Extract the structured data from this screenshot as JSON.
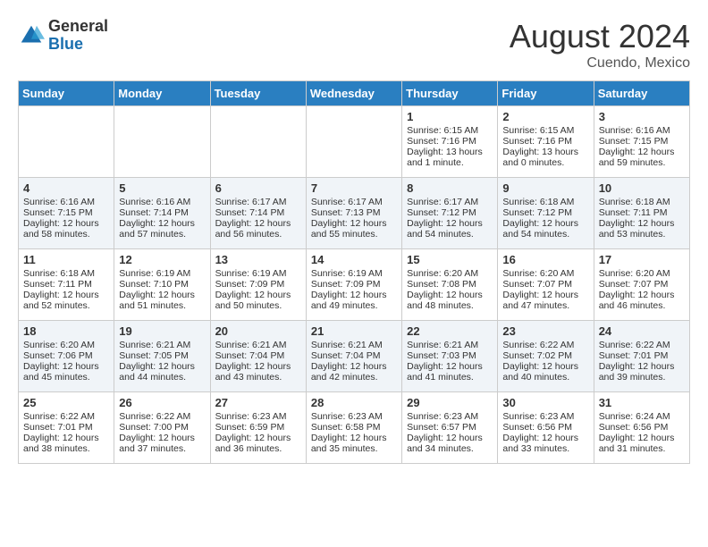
{
  "header": {
    "logo_general": "General",
    "logo_blue": "Blue",
    "month_year": "August 2024",
    "location": "Cuendo, Mexico"
  },
  "days_of_week": [
    "Sunday",
    "Monday",
    "Tuesday",
    "Wednesday",
    "Thursday",
    "Friday",
    "Saturday"
  ],
  "weeks": [
    [
      {
        "day": "",
        "sunrise": "",
        "sunset": "",
        "daylight": ""
      },
      {
        "day": "",
        "sunrise": "",
        "sunset": "",
        "daylight": ""
      },
      {
        "day": "",
        "sunrise": "",
        "sunset": "",
        "daylight": ""
      },
      {
        "day": "",
        "sunrise": "",
        "sunset": "",
        "daylight": ""
      },
      {
        "day": "1",
        "sunrise": "Sunrise: 6:15 AM",
        "sunset": "Sunset: 7:16 PM",
        "daylight": "Daylight: 13 hours and 1 minute."
      },
      {
        "day": "2",
        "sunrise": "Sunrise: 6:15 AM",
        "sunset": "Sunset: 7:16 PM",
        "daylight": "Daylight: 13 hours and 0 minutes."
      },
      {
        "day": "3",
        "sunrise": "Sunrise: 6:16 AM",
        "sunset": "Sunset: 7:15 PM",
        "daylight": "Daylight: 12 hours and 59 minutes."
      }
    ],
    [
      {
        "day": "4",
        "sunrise": "Sunrise: 6:16 AM",
        "sunset": "Sunset: 7:15 PM",
        "daylight": "Daylight: 12 hours and 58 minutes."
      },
      {
        "day": "5",
        "sunrise": "Sunrise: 6:16 AM",
        "sunset": "Sunset: 7:14 PM",
        "daylight": "Daylight: 12 hours and 57 minutes."
      },
      {
        "day": "6",
        "sunrise": "Sunrise: 6:17 AM",
        "sunset": "Sunset: 7:14 PM",
        "daylight": "Daylight: 12 hours and 56 minutes."
      },
      {
        "day": "7",
        "sunrise": "Sunrise: 6:17 AM",
        "sunset": "Sunset: 7:13 PM",
        "daylight": "Daylight: 12 hours and 55 minutes."
      },
      {
        "day": "8",
        "sunrise": "Sunrise: 6:17 AM",
        "sunset": "Sunset: 7:12 PM",
        "daylight": "Daylight: 12 hours and 54 minutes."
      },
      {
        "day": "9",
        "sunrise": "Sunrise: 6:18 AM",
        "sunset": "Sunset: 7:12 PM",
        "daylight": "Daylight: 12 hours and 54 minutes."
      },
      {
        "day": "10",
        "sunrise": "Sunrise: 6:18 AM",
        "sunset": "Sunset: 7:11 PM",
        "daylight": "Daylight: 12 hours and 53 minutes."
      }
    ],
    [
      {
        "day": "11",
        "sunrise": "Sunrise: 6:18 AM",
        "sunset": "Sunset: 7:11 PM",
        "daylight": "Daylight: 12 hours and 52 minutes."
      },
      {
        "day": "12",
        "sunrise": "Sunrise: 6:19 AM",
        "sunset": "Sunset: 7:10 PM",
        "daylight": "Daylight: 12 hours and 51 minutes."
      },
      {
        "day": "13",
        "sunrise": "Sunrise: 6:19 AM",
        "sunset": "Sunset: 7:09 PM",
        "daylight": "Daylight: 12 hours and 50 minutes."
      },
      {
        "day": "14",
        "sunrise": "Sunrise: 6:19 AM",
        "sunset": "Sunset: 7:09 PM",
        "daylight": "Daylight: 12 hours and 49 minutes."
      },
      {
        "day": "15",
        "sunrise": "Sunrise: 6:20 AM",
        "sunset": "Sunset: 7:08 PM",
        "daylight": "Daylight: 12 hours and 48 minutes."
      },
      {
        "day": "16",
        "sunrise": "Sunrise: 6:20 AM",
        "sunset": "Sunset: 7:07 PM",
        "daylight": "Daylight: 12 hours and 47 minutes."
      },
      {
        "day": "17",
        "sunrise": "Sunrise: 6:20 AM",
        "sunset": "Sunset: 7:07 PM",
        "daylight": "Daylight: 12 hours and 46 minutes."
      }
    ],
    [
      {
        "day": "18",
        "sunrise": "Sunrise: 6:20 AM",
        "sunset": "Sunset: 7:06 PM",
        "daylight": "Daylight: 12 hours and 45 minutes."
      },
      {
        "day": "19",
        "sunrise": "Sunrise: 6:21 AM",
        "sunset": "Sunset: 7:05 PM",
        "daylight": "Daylight: 12 hours and 44 minutes."
      },
      {
        "day": "20",
        "sunrise": "Sunrise: 6:21 AM",
        "sunset": "Sunset: 7:04 PM",
        "daylight": "Daylight: 12 hours and 43 minutes."
      },
      {
        "day": "21",
        "sunrise": "Sunrise: 6:21 AM",
        "sunset": "Sunset: 7:04 PM",
        "daylight": "Daylight: 12 hours and 42 minutes."
      },
      {
        "day": "22",
        "sunrise": "Sunrise: 6:21 AM",
        "sunset": "Sunset: 7:03 PM",
        "daylight": "Daylight: 12 hours and 41 minutes."
      },
      {
        "day": "23",
        "sunrise": "Sunrise: 6:22 AM",
        "sunset": "Sunset: 7:02 PM",
        "daylight": "Daylight: 12 hours and 40 minutes."
      },
      {
        "day": "24",
        "sunrise": "Sunrise: 6:22 AM",
        "sunset": "Sunset: 7:01 PM",
        "daylight": "Daylight: 12 hours and 39 minutes."
      }
    ],
    [
      {
        "day": "25",
        "sunrise": "Sunrise: 6:22 AM",
        "sunset": "Sunset: 7:01 PM",
        "daylight": "Daylight: 12 hours and 38 minutes."
      },
      {
        "day": "26",
        "sunrise": "Sunrise: 6:22 AM",
        "sunset": "Sunset: 7:00 PM",
        "daylight": "Daylight: 12 hours and 37 minutes."
      },
      {
        "day": "27",
        "sunrise": "Sunrise: 6:23 AM",
        "sunset": "Sunset: 6:59 PM",
        "daylight": "Daylight: 12 hours and 36 minutes."
      },
      {
        "day": "28",
        "sunrise": "Sunrise: 6:23 AM",
        "sunset": "Sunset: 6:58 PM",
        "daylight": "Daylight: 12 hours and 35 minutes."
      },
      {
        "day": "29",
        "sunrise": "Sunrise: 6:23 AM",
        "sunset": "Sunset: 6:57 PM",
        "daylight": "Daylight: 12 hours and 34 minutes."
      },
      {
        "day": "30",
        "sunrise": "Sunrise: 6:23 AM",
        "sunset": "Sunset: 6:56 PM",
        "daylight": "Daylight: 12 hours and 33 minutes."
      },
      {
        "day": "31",
        "sunrise": "Sunrise: 6:24 AM",
        "sunset": "Sunset: 6:56 PM",
        "daylight": "Daylight: 12 hours and 31 minutes."
      }
    ]
  ]
}
